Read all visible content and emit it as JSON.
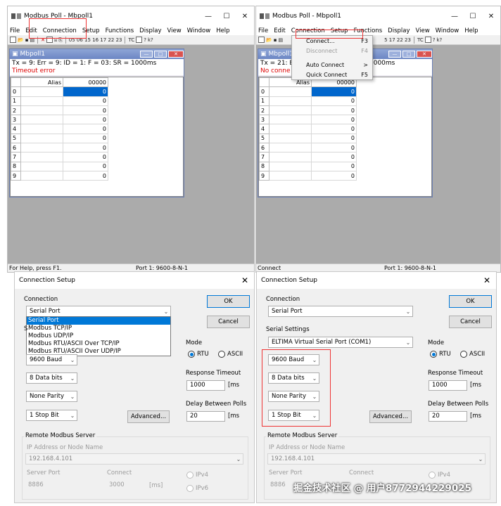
{
  "left_app": {
    "title": "Modbus Poll - Mbpoll1",
    "menu": [
      "File",
      "Edit",
      "Connection",
      "Setup",
      "Functions",
      "Display",
      "View",
      "Window",
      "Help"
    ],
    "toolbar_codes": "05 06 15 16 17 22 23",
    "toolbar_tc": "TC",
    "status_left": "For Help, press F1.",
    "status_right": "Port 1: 9600-8-N-1",
    "child": {
      "title": "Mbpoll1",
      "info": "Tx = 9: Err = 9: ID = 1: F = 03: SR = 1000ms",
      "error": "Timeout error",
      "header_alias": "Alias",
      "header_addr": "00000",
      "rows": [
        "0",
        "1",
        "2",
        "3",
        "4",
        "5",
        "6",
        "7",
        "8",
        "9"
      ],
      "value": "0"
    }
  },
  "right_app": {
    "title": "Modbus Poll - Mbpoll1",
    "menu": [
      "File",
      "Edit",
      "Connection",
      "Setup",
      "Functions",
      "Display",
      "View",
      "Window",
      "Help"
    ],
    "toolbar_codes": "5 17 22 23",
    "toolbar_tc": "TC",
    "status_left": "Connect",
    "status_right": "Port 1: 9600-8-N-1",
    "child": {
      "title": "Mbpoll1",
      "info": "Tx = 21: E",
      "info2": "1000ms",
      "error": "No conne",
      "header_alias": "Alias",
      "header_addr": "00000",
      "rows": [
        "0",
        "1",
        "2",
        "3",
        "4",
        "5",
        "6",
        "7",
        "8",
        "9"
      ],
      "value": "0"
    },
    "dropdown": [
      {
        "label": "Connect...",
        "key": "F3",
        "disabled": false
      },
      {
        "label": "Disconnect",
        "key": "F4",
        "disabled": true
      },
      {
        "label": "Auto Connect",
        "key": ">",
        "disabled": false
      },
      {
        "label": "Quick Connect",
        "key": "F5",
        "disabled": false
      }
    ]
  },
  "left_dialog": {
    "title": "Connection Setup",
    "connection_label": "Connection",
    "connection_value": "Serial Port",
    "list_options": [
      "Serial Port",
      "Modbus TCP/IP",
      "Modbus UDP/IP",
      "Modbus RTU/ASCII Over TCP/IP",
      "Modbus RTU/ASCII Over UDP/IP"
    ],
    "baud": "9600 Baud",
    "data_bits": "8 Data bits",
    "parity": "None Parity",
    "stop_bit": "1 Stop Bit",
    "ok": "OK",
    "cancel": "Cancel",
    "mode_label": "Mode",
    "rtu": "RTU",
    "ascii": "ASCII",
    "response_timeout_label": "Response Timeout",
    "response_timeout": "1000",
    "ms": "[ms",
    "delay_label": "Delay Between Polls",
    "delay": "20",
    "advanced": "Advanced...",
    "remote_label": "Remote Modbus Server",
    "ip_label": "IP Address or Node Name",
    "ip": "192.168.4.101",
    "server_port_label": "Server Port",
    "server_port": "8886",
    "connect_label": "Connect",
    "connect_value": "3000",
    "ms2": "[ms]",
    "ipv4": "IPv4",
    "ipv6": "IPv6"
  },
  "right_dialog": {
    "title": "Connection Setup",
    "connection_label": "Connection",
    "connection_value": "Serial Port",
    "serial_settings_label": "Serial Settings",
    "serial_port": "ELTIMA Virtual Serial Port (COM1)",
    "baud": "9600 Baud",
    "data_bits": "8 Data bits",
    "parity": "None Parity",
    "stop_bit": "1 Stop Bit",
    "ok": "OK",
    "cancel": "Cancel",
    "mode_label": "Mode",
    "rtu": "RTU",
    "ascii": "ASCII",
    "response_timeout_label": "Response Timeout",
    "response_timeout": "1000",
    "ms": "[ms",
    "delay_label": "Delay Between Polls",
    "delay": "20",
    "advanced": "Advanced...",
    "remote_label": "Remote Modbus Server",
    "ip_label": "IP Address or Node Name",
    "ip": "192.168.4.101",
    "server_port_label": "Server Port",
    "server_port": "8886",
    "connect_label": "Connect",
    "ipv4": "IPv4",
    "watermark": "掘金技术社区 @ 用户8772944229025"
  },
  "colors": {
    "highlight": "#0078d7",
    "annotation": "#e33333",
    "error": "#dd0000"
  }
}
